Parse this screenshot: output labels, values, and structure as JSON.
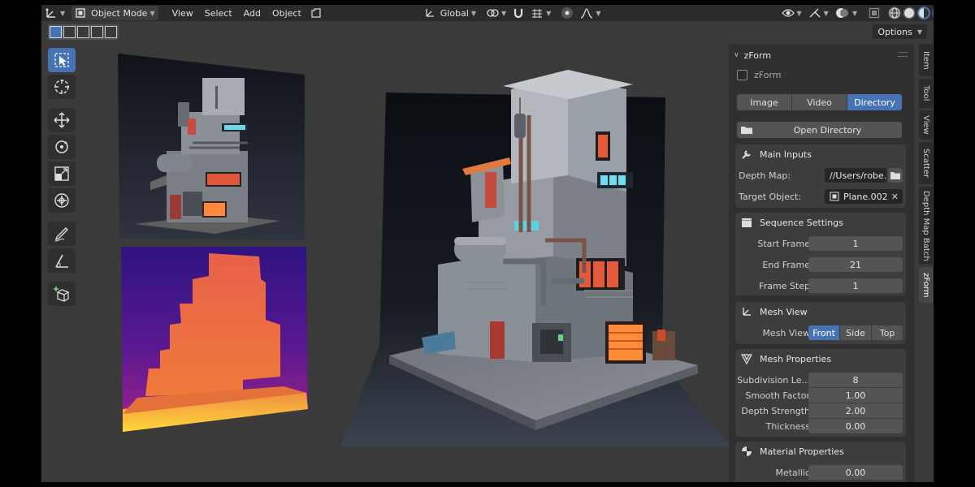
{
  "header": {
    "mode": "Object Mode",
    "menus": [
      "View",
      "Select",
      "Add",
      "Object"
    ],
    "transform_orientation": "Global",
    "options_label": "Options"
  },
  "tabs": [
    "Item",
    "Tool",
    "View",
    "Scatter",
    "Depth Map Batch",
    "zForm"
  ],
  "panel": {
    "title": "zForm",
    "checkbox_label": "zForm",
    "source_options": [
      "Image",
      "Video",
      "Directory"
    ],
    "source_selected": "Directory",
    "open_directory": "Open Directory",
    "main_inputs": {
      "title": "Main Inputs",
      "depth_map_label": "Depth Map:",
      "depth_map_value": "//Users/robe...",
      "target_object_label": "Target Object:",
      "target_object_value": "Plane.002"
    },
    "sequence": {
      "title": "Sequence Settings",
      "start_frame_label": "Start Frame",
      "start_frame": "1",
      "end_frame_label": "End Frame",
      "end_frame": "21",
      "frame_step_label": "Frame Step",
      "frame_step": "1"
    },
    "mesh_view": {
      "title": "Mesh View",
      "label": "Mesh View",
      "options": [
        "Front",
        "Side",
        "Top"
      ],
      "selected": "Front"
    },
    "mesh_properties": {
      "title": "Mesh Properties",
      "subdivision_label": "Subdivision Le...",
      "subdivision": "8",
      "smooth_label": "Smooth Factor",
      "smooth": "1.00",
      "depth_label": "Depth Strength",
      "depth": "2.00",
      "thickness_label": "Thickness",
      "thickness": "0.00"
    },
    "material_properties": {
      "title": "Material Properties",
      "metallic_label": "Metallic",
      "metallic": "0.00"
    }
  },
  "colors": {
    "accent": "#4772b3",
    "panel_bg": "#303030",
    "section_bg": "#3d3d3d",
    "field_bg": "#545454",
    "viewport_bg": "#3a3a3a"
  }
}
